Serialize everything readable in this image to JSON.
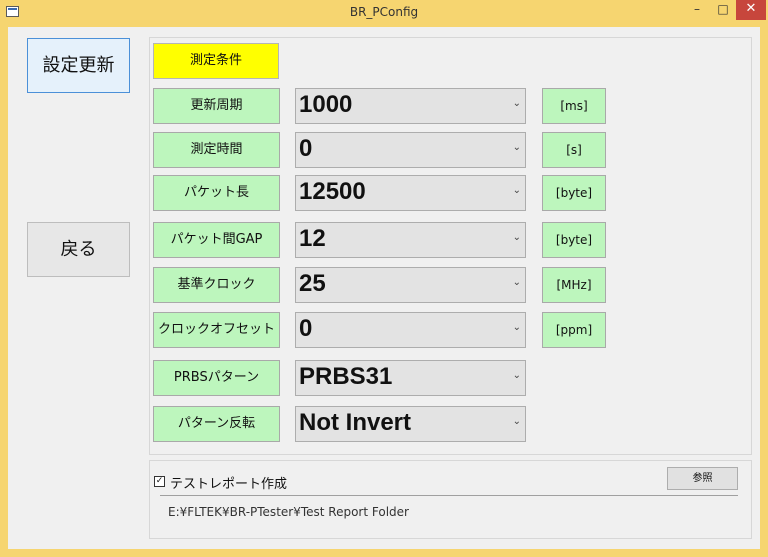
{
  "window": {
    "title": "BR_PConfig",
    "min_glyph": "–",
    "max_glyph": "□",
    "close_glyph": "✕"
  },
  "sidebar": {
    "update_label": "設定更新",
    "back_label": "戻る"
  },
  "conditions": {
    "header": "測定条件",
    "rows": [
      {
        "label": "更新周期",
        "value": "1000",
        "unit": "[ms]"
      },
      {
        "label": "測定時間",
        "value": "0",
        "unit": "[s]"
      },
      {
        "label": "パケット長",
        "value": "12500",
        "unit": "[byte]"
      },
      {
        "label": "パケット間GAP",
        "value": "12",
        "unit": "[byte]"
      },
      {
        "label": "基準クロック",
        "value": "25",
        "unit": "[MHz]"
      },
      {
        "label": "クロックオフセット",
        "value": "0",
        "unit": "[ppm]"
      },
      {
        "label": "PRBSパターン",
        "value": "PRBS31",
        "unit": ""
      },
      {
        "label": "パターン反転",
        "value": "Not Invert",
        "unit": ""
      }
    ]
  },
  "report": {
    "checkbox_label": "テストレポート作成",
    "checked": true,
    "checkmark": "✓",
    "browse_label": "参照",
    "path": "E:¥FLTEK¥BR-PTester¥Test Report Folder"
  },
  "icons": {
    "dropdown": "chevron-down-icon"
  },
  "colors": {
    "window_frame": "#f6d570",
    "header_label": "#ffff00",
    "row_label": "#bdf6bd",
    "close_button": "#c7463c"
  }
}
